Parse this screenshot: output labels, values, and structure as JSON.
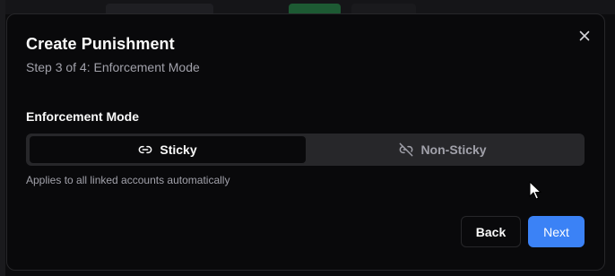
{
  "modal": {
    "title": "Create Punishment",
    "subtitle": "Step 3 of 4: Enforcement Mode",
    "close_icon": "close-icon"
  },
  "enforcement": {
    "label": "Enforcement Mode",
    "options": [
      {
        "label": "Sticky",
        "icon": "link-icon",
        "selected": true
      },
      {
        "label": "Non-Sticky",
        "icon": "broken-link-icon",
        "selected": false
      }
    ],
    "hint": "Applies to all linked accounts automatically"
  },
  "actions": {
    "back_label": "Back",
    "next_label": "Next"
  },
  "colors": {
    "accent": "#3b82f6",
    "background": "#09090b",
    "muted_text": "#a1a1aa"
  }
}
